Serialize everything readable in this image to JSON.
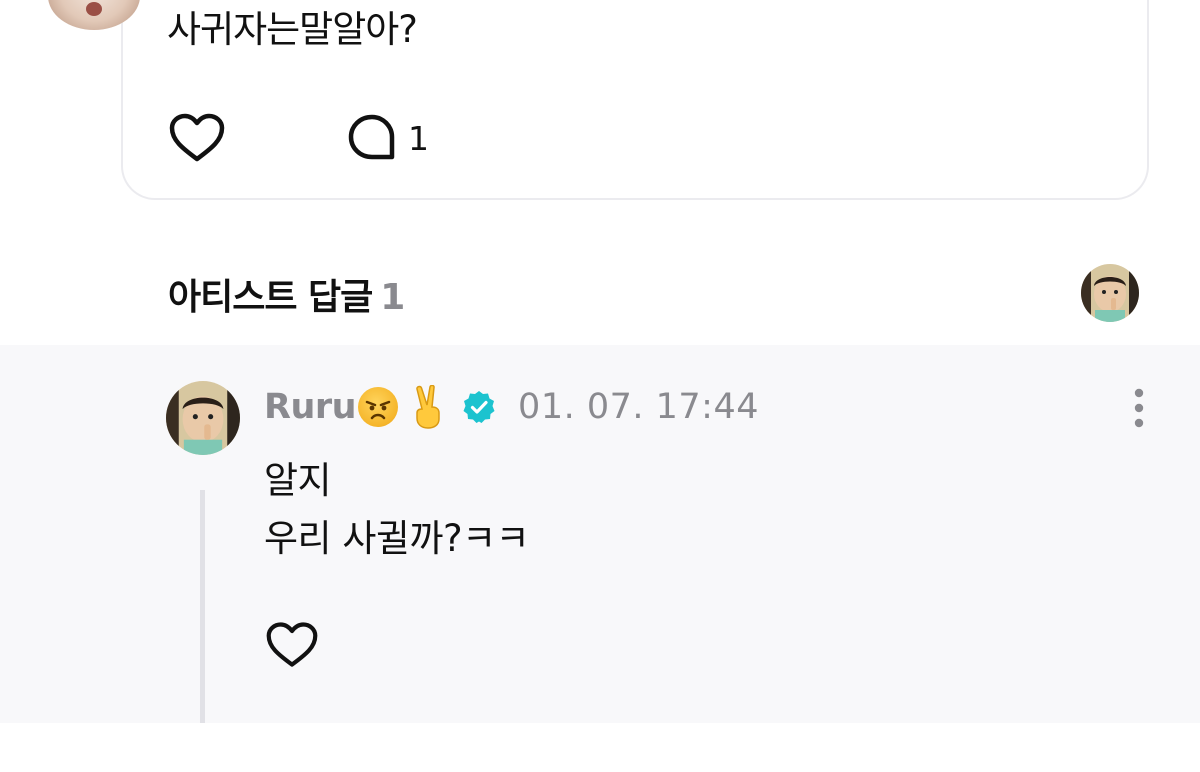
{
  "post": {
    "text": "사귀자는말알아?",
    "comment_count": "1"
  },
  "artist_replies": {
    "title": "아티스트 답글",
    "count": "1"
  },
  "reply": {
    "name": "Ruru",
    "timestamp": "01. 07. 17:44",
    "lines": [
      "알지",
      "우리 사귈까?ㅋㅋ"
    ]
  },
  "icons": {
    "like": "heart-icon",
    "comment": "comment-bubble-icon",
    "verified": "verified-badge-icon",
    "more": "more-vertical-icon",
    "emoji_1": "angry-face-emoji",
    "emoji_2": "victory-hand-emoji"
  },
  "colors": {
    "verified": "#1cc3cf",
    "muted_text": "#8a8a8f",
    "reply_background": "#f8f8fa"
  }
}
